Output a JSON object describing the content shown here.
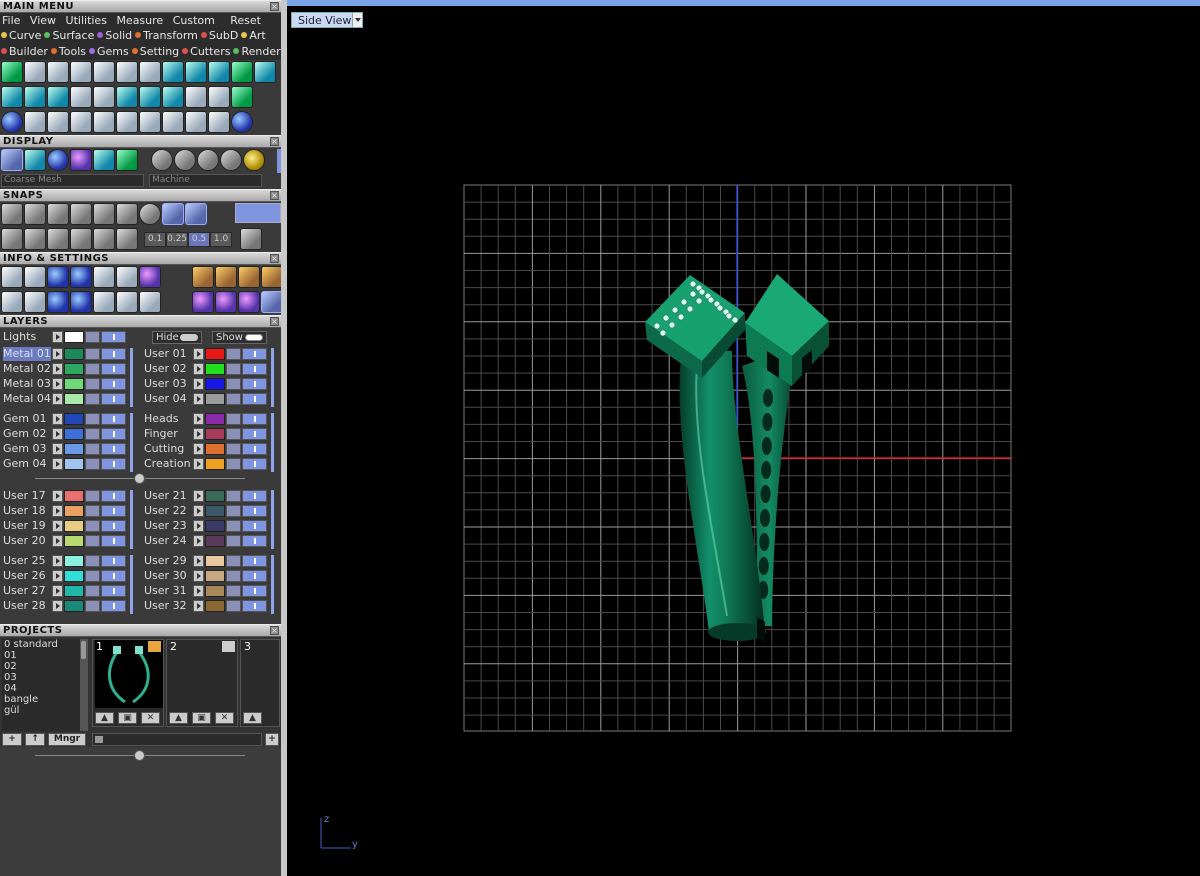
{
  "main_menu": {
    "header": "MAIN MENU",
    "menubar": [
      "File",
      "View",
      "Utilities",
      "Measure",
      "Custom"
    ],
    "reset_label": "Reset",
    "modules": [
      {
        "label": "Curve",
        "color": "#e6c84a"
      },
      {
        "label": "Surface",
        "color": "#58c060"
      },
      {
        "label": "Solid",
        "color": "#a060d0"
      },
      {
        "label": "Transform",
        "color": "#e07030"
      },
      {
        "label": "SubD",
        "color": "#e05050"
      },
      {
        "label": "Art",
        "color": "#e6c84a"
      },
      {
        "label": "Builder",
        "color": "#e05050"
      },
      {
        "label": "Tools",
        "color": "#e07030"
      },
      {
        "label": "Gems",
        "color": "#a070e0"
      },
      {
        "label": "Setting",
        "color": "#e07030"
      },
      {
        "label": "Cutters",
        "color": "#e05050"
      },
      {
        "label": "Render",
        "color": "#58c060"
      }
    ]
  },
  "display": {
    "header": "DISPLAY",
    "mesh_option": "Coarse Mesh",
    "material_option": "Machine"
  },
  "snaps": {
    "header": "SNAPS",
    "values": [
      "0.1",
      "0.25",
      "0.5",
      "1.0"
    ],
    "active_value": "0.5"
  },
  "info_settings": {
    "header": "INFO & SETTINGS"
  },
  "layers": {
    "header": "LAYERS",
    "lights_label": "Lights",
    "hide_label": "Hide",
    "show_label": "Show",
    "left": [
      {
        "name": "Metal 01",
        "color": "#1b8a5a",
        "selected": true
      },
      {
        "name": "Metal 02",
        "color": "#2da860"
      },
      {
        "name": "Metal 03",
        "color": "#6fd878"
      },
      {
        "name": "Metal 04",
        "color": "#a8e8a8"
      },
      {
        "name": "Gem 01",
        "color": "#1f47b8"
      },
      {
        "name": "Gem 02",
        "color": "#3c70d8"
      },
      {
        "name": "Gem 03",
        "color": "#6a9ae8"
      },
      {
        "name": "Gem 04",
        "color": "#a0c4f0"
      },
      {
        "name": "User 17",
        "color": "#e87070"
      },
      {
        "name": "User 18",
        "color": "#e8a060"
      },
      {
        "name": "User 19",
        "color": "#e8cc80"
      },
      {
        "name": "User 20",
        "color": "#b8d870"
      },
      {
        "name": "User 25",
        "color": "#8cf0e0"
      },
      {
        "name": "User 26",
        "color": "#30e0d8"
      },
      {
        "name": "User 27",
        "color": "#20b8a8"
      },
      {
        "name": "User 28",
        "color": "#1a8878"
      }
    ],
    "right": [
      {
        "name": "User 01",
        "color": "#e81818"
      },
      {
        "name": "User 02",
        "color": "#20e020"
      },
      {
        "name": "User 03",
        "color": "#1818e8"
      },
      {
        "name": "User 04",
        "color": "#9a9a9a"
      },
      {
        "name": "Heads",
        "color": "#8a2aa8"
      },
      {
        "name": "Finger",
        "color": "#a83a5a"
      },
      {
        "name": "Cutting",
        "color": "#e07030"
      },
      {
        "name": "Creation",
        "color": "#f0a020"
      },
      {
        "name": "User 21",
        "color": "#3a6a58"
      },
      {
        "name": "User 22",
        "color": "#3a5868"
      },
      {
        "name": "User 23",
        "color": "#3a3a68"
      },
      {
        "name": "User 24",
        "color": "#5a3a5a"
      },
      {
        "name": "User 29",
        "color": "#e8c8a0"
      },
      {
        "name": "User 30",
        "color": "#c8a880"
      },
      {
        "name": "User 31",
        "color": "#a88858"
      },
      {
        "name": "User 32",
        "color": "#886830"
      }
    ]
  },
  "projects": {
    "header": "PROJECTS",
    "list": [
      "0 standard",
      "01",
      "02",
      "03",
      "04",
      "bangle",
      "gül"
    ],
    "slots": [
      "1",
      "2",
      "3"
    ],
    "mngr_label": "Mngr"
  },
  "viewport": {
    "view_name": "Side View",
    "axis_z": "z",
    "axis_y": "y",
    "model_color": "#0d6b4a",
    "grid_color": "#7a7a7a",
    "axis_blue": "#2a3fd0",
    "axis_red": "#d01818"
  }
}
